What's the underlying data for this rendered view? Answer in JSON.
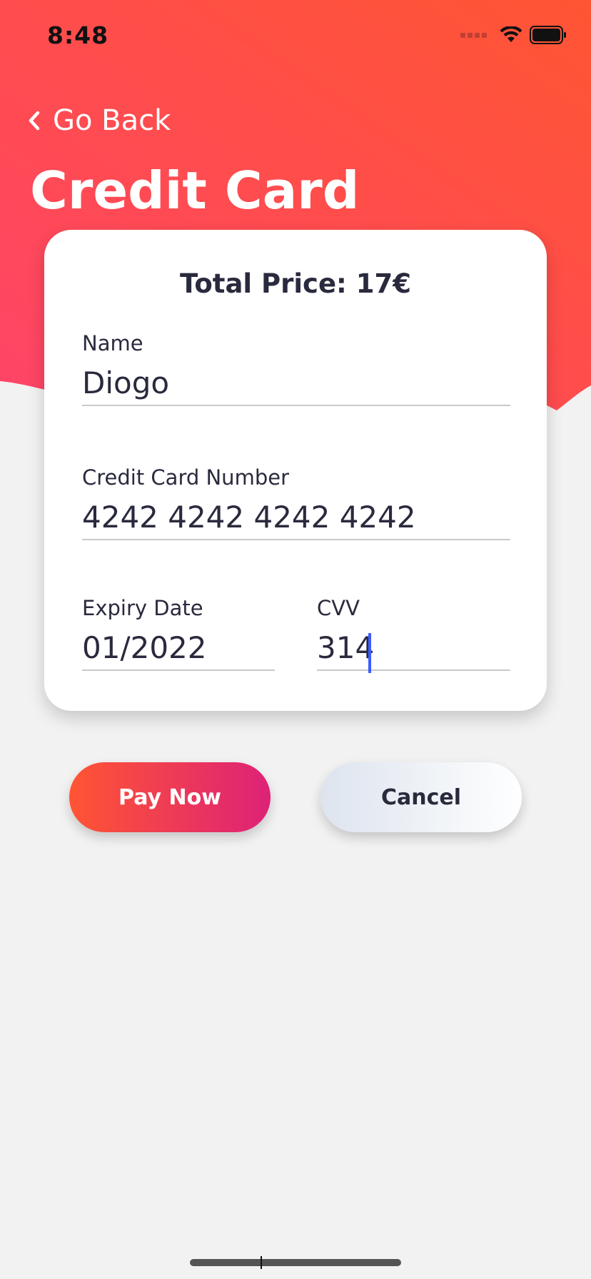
{
  "status_bar": {
    "time": "8:48"
  },
  "header": {
    "back_label": "Go Back",
    "title": "Credit Card"
  },
  "card": {
    "total_price": "Total Price: 17€",
    "name": {
      "label": "Name",
      "value": "Diogo"
    },
    "card_number": {
      "label": "Credit Card Number",
      "value": "4242 4242 4242 4242"
    },
    "expiry": {
      "label": "Expiry Date",
      "value": "01/2022"
    },
    "cvv": {
      "label": "CVV",
      "value": "314"
    }
  },
  "actions": {
    "pay_label": "Pay Now",
    "cancel_label": "Cancel"
  },
  "icons": {
    "back": "chevron-left-icon",
    "signal": "cellular-signal-icon",
    "wifi": "wifi-icon",
    "battery": "battery-icon"
  },
  "colors": {
    "header_gradient_start": "#ff4468",
    "header_gradient_end": "#ff5533",
    "pay_gradient_start": "#ff5533",
    "pay_gradient_end": "#dd2277",
    "text_dark": "#2a2a3e",
    "caret": "#3d5cff",
    "background": "#f2f2f2"
  }
}
